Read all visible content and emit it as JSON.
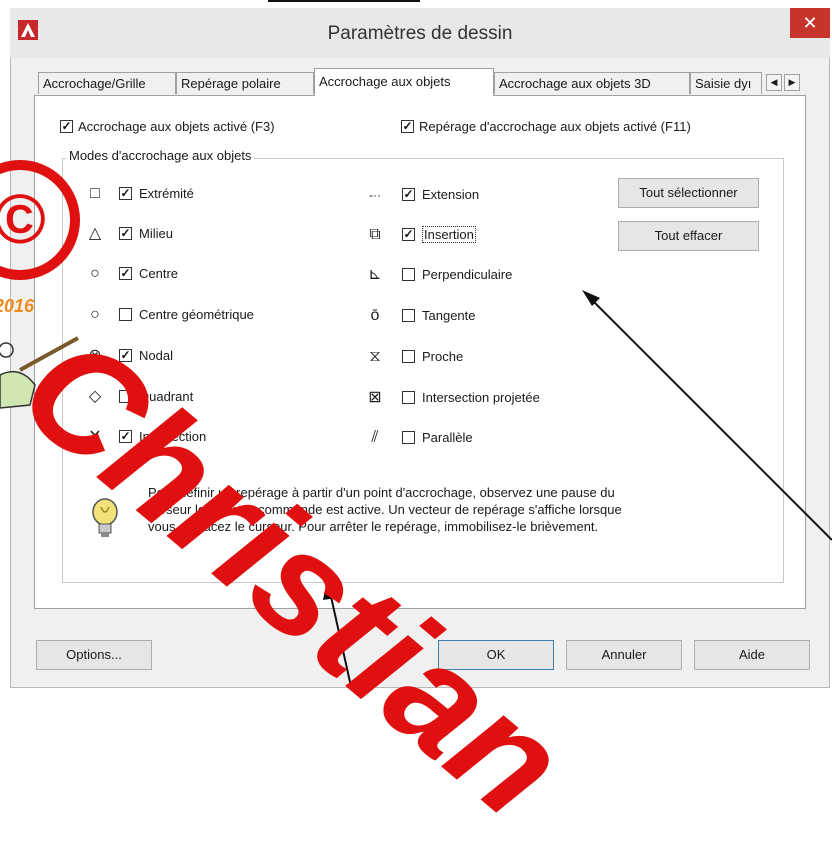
{
  "window": {
    "title": "Paramètres de dessin",
    "close": "✕"
  },
  "tabs": [
    {
      "label": "Accrochage/Grille"
    },
    {
      "label": "Repérage polaire"
    },
    {
      "label": "Accrochage aux objets"
    },
    {
      "label": "Accrochage aux objets 3D"
    },
    {
      "label": "Saisie dyı"
    }
  ],
  "tab_scroll": {
    "left": "◀",
    "right": "▶"
  },
  "top_checks": {
    "osnap_on": {
      "label": "Accrochage aux objets activé (F3)",
      "checked": true
    },
    "tracking_on": {
      "label": "Repérage d'accrochage aux objets activé (F11)",
      "checked": true
    }
  },
  "group": {
    "title": "Modes d'accrochage aux objets"
  },
  "modes_left": [
    {
      "label": "Extrémité",
      "checked": true,
      "symbol": "□"
    },
    {
      "label": "Milieu",
      "checked": true,
      "symbol": "△"
    },
    {
      "label": "Centre",
      "checked": true,
      "symbol": "○"
    },
    {
      "label": "Centre géométrique",
      "checked": false,
      "symbol": "○"
    },
    {
      "label": "Nodal",
      "checked": true,
      "symbol": "⊗"
    },
    {
      "label": "Quadrant",
      "checked": false,
      "symbol": "◇"
    },
    {
      "label": "Intersection",
      "checked": true,
      "symbol": "✕"
    }
  ],
  "modes_right": [
    {
      "label": "Extension",
      "checked": true,
      "symbol": "-··"
    },
    {
      "label": "Insertion",
      "checked": true,
      "symbol": "⧉"
    },
    {
      "label": "Perpendiculaire",
      "checked": false,
      "symbol": "⊾"
    },
    {
      "label": "Tangente",
      "checked": false,
      "symbol": "ō"
    },
    {
      "label": "Proche",
      "checked": false,
      "symbol": "⧖"
    },
    {
      "label": "Intersection projetée",
      "checked": false,
      "symbol": "⊠"
    },
    {
      "label": "Parallèle",
      "checked": false,
      "symbol": "⫽"
    }
  ],
  "buttons": {
    "select_all": "Tout sélectionner",
    "clear_all": "Tout effacer",
    "options": "Options...",
    "ok": "OK",
    "cancel": "Annuler",
    "help": "Aide"
  },
  "info": {
    "line1": "Pour définir un repérage à partir d'un point d'accrochage, observez une pause du",
    "line2": "curseur lorsqu'une commande est active. Un vecteur de repérage s'affiche lorsque",
    "line3": "vous déplacez le curseur. Pour arrêter le repérage, immobilisez-le brièvement."
  },
  "watermark": {
    "text": "Christian",
    "copyright": "©",
    "year": "2016"
  },
  "colors": {
    "accent_red": "#e01010",
    "close_red": "#c7342c",
    "year_orange": "#f08a1a"
  }
}
